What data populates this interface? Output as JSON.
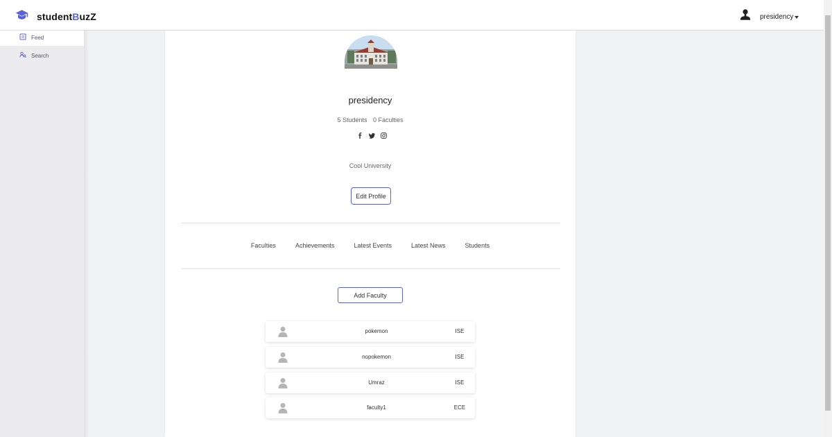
{
  "navbar": {
    "brand_prefix": "student",
    "brand_accent": "B",
    "brand_suffix": "uzZ",
    "brand_icon": "graduation-cap-icon",
    "user_name": "presidency",
    "user_icon": "user-silhouette-icon"
  },
  "sidebar": {
    "items": [
      {
        "label": "Feed",
        "icon": "feed-icon"
      },
      {
        "label": "Search",
        "icon": "search-people-icon"
      }
    ]
  },
  "profile": {
    "name": "presidency",
    "students_count": "5 Students",
    "faculties_count": "0 Faculties",
    "socials": [
      "facebook-icon",
      "twitter-icon",
      "instagram-icon"
    ],
    "description": "Cool University",
    "edit_label": "Edit Profile"
  },
  "tabs": [
    "Faculties",
    "Achievements",
    "Latest Events",
    "Latest News",
    "Students"
  ],
  "add_faculty_label": "Add Faculty",
  "faculties": [
    {
      "name": "pokemon",
      "dept": "ISE"
    },
    {
      "name": "nopokemon",
      "dept": "ISE"
    },
    {
      "name": "Umraz",
      "dept": "ISE"
    },
    {
      "name": "faculty1",
      "dept": "ECE"
    }
  ],
  "colors": {
    "accent": "#5a62d8",
    "background": "#f1f2f4"
  }
}
